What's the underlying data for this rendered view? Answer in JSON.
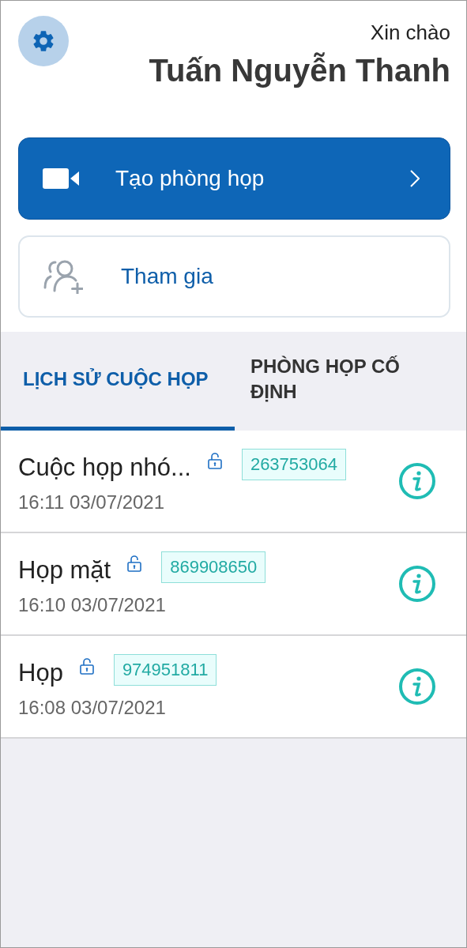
{
  "header": {
    "greeting": "Xin chào",
    "user_name": "Tuấn Nguyễn Thanh"
  },
  "actions": [
    {
      "kind": "primary",
      "label": "Tạo phòng họp"
    },
    {
      "kind": "secondary",
      "label": "Tham gia"
    }
  ],
  "tabs": [
    {
      "label": "LỊCH SỬ CUỘC HỌP",
      "selected": true
    },
    {
      "label": "PHÒNG HỌP CỐ ĐỊNH",
      "selected": false
    }
  ],
  "meetings": [
    {
      "title": "Cuộc họp nhó...",
      "meeting_id": "263753064",
      "time": "16:11 03/07/2021"
    },
    {
      "title": "Họp mặt",
      "meeting_id": "869908650",
      "time": "16:10 03/07/2021"
    },
    {
      "title": "Họp",
      "meeting_id": "974951811",
      "time": "16:08 03/07/2021"
    }
  ]
}
